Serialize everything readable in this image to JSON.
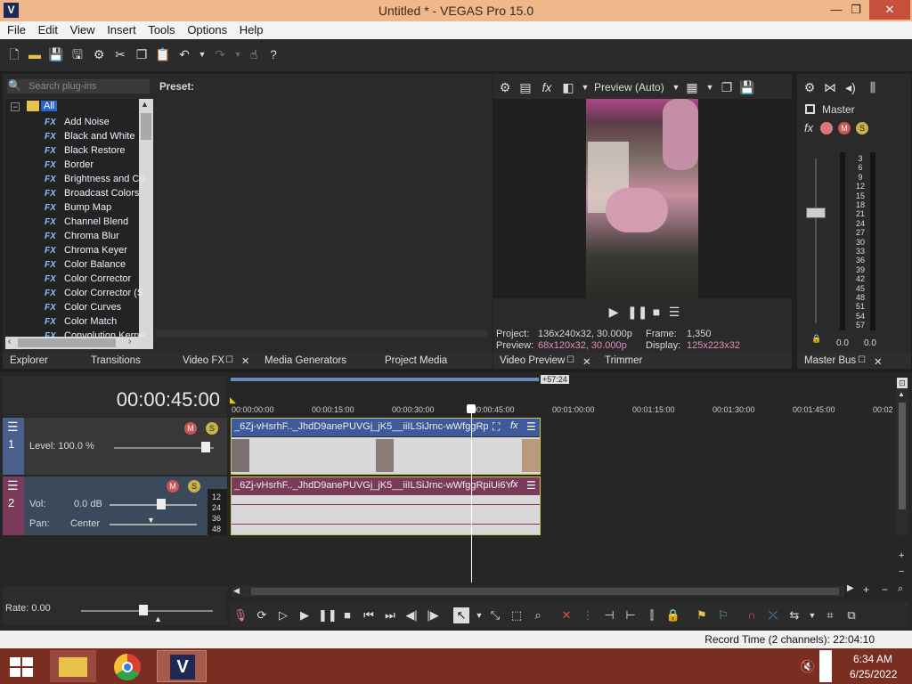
{
  "window": {
    "logo": "V",
    "title": "Untitled * - VEGAS Pro 15.0",
    "minimize": "—",
    "maximize": "❐",
    "close": "✕"
  },
  "menu": [
    "File",
    "Edit",
    "View",
    "Insert",
    "Tools",
    "Options",
    "Help"
  ],
  "plugins": {
    "search_placeholder": "Search plug-ins",
    "preset_label": "Preset:",
    "root_label": "All",
    "fx_badge": "FX",
    "items": [
      "Add Noise",
      "Black and White",
      "Black Restore",
      "Border",
      "Brightness and Co",
      "Broadcast Colors",
      "Bump Map",
      "Channel Blend",
      "Chroma Blur",
      "Chroma Keyer",
      "Color Balance",
      "Color Corrector",
      "Color Corrector (S",
      "Color Curves",
      "Color Match",
      "Convolution Kerne"
    ]
  },
  "left_tabs": [
    "Explorer",
    "Transitions",
    "Video FX",
    "Media Generators",
    "Project Media"
  ],
  "preview": {
    "mode": "Preview (Auto)",
    "project_label": "Project:",
    "project_value": "136x240x32, 30.000p",
    "preview_label": "Preview:",
    "preview_value": "68x120x32, 30.000p",
    "frame_label": "Frame:",
    "frame_value": "1,350",
    "display_label": "Display:",
    "display_value": "125x223x32",
    "tabs": [
      "Video Preview",
      "Trimmer"
    ]
  },
  "master": {
    "label": "Master",
    "scale": [
      "3",
      "6",
      "9",
      "12",
      "15",
      "18",
      "21",
      "24",
      "27",
      "30",
      "33",
      "36",
      "39",
      "42",
      "45",
      "48",
      "51",
      "54",
      "57"
    ],
    "left_value": "0.0",
    "right_value": "0.0",
    "tab": "Master Bus"
  },
  "timeline": {
    "timecode": "00:00:45:00",
    "loop_badge": "+57:24",
    "ruler": [
      "00:00:00:00",
      "00:00:15:00",
      "00:00:30:00",
      "00:00:45:00",
      "00:01:00:00",
      "00:01:15:00",
      "00:01:30:00",
      "00:01:45:00",
      "00:02"
    ],
    "video_track": {
      "number": "1",
      "level": "Level: 100.0 %",
      "clip_name": "_6Zj-vHsrhF.._JhdD9anePUVGj_jK5__iiILSiJrnc-wWfggRpi..."
    },
    "audio_track": {
      "number": "2",
      "vol_label": "Vol:",
      "vol_value": "0.0 dB",
      "pan_label": "Pan:",
      "pan_value": "Center",
      "meter_scale": [
        "12",
        "24",
        "36",
        "48"
      ],
      "clip_name": "_6Zj-vHsrhF.._JhdD9anePUVGj_jK5__iiILSiJrnc-wWfggRpiUi6Y..."
    },
    "rate": "Rate: 0.00"
  },
  "status": {
    "record_time": "Record Time (2 channels): 22:04:10"
  },
  "taskbar": {
    "time": "6:34 AM",
    "date": "6/25/2022"
  },
  "colors": {
    "accent": "#f0b88a",
    "video_clip": "#3f5a9b",
    "audio_clip": "#7a3a5a",
    "track_selected": "#4a5f8c"
  }
}
